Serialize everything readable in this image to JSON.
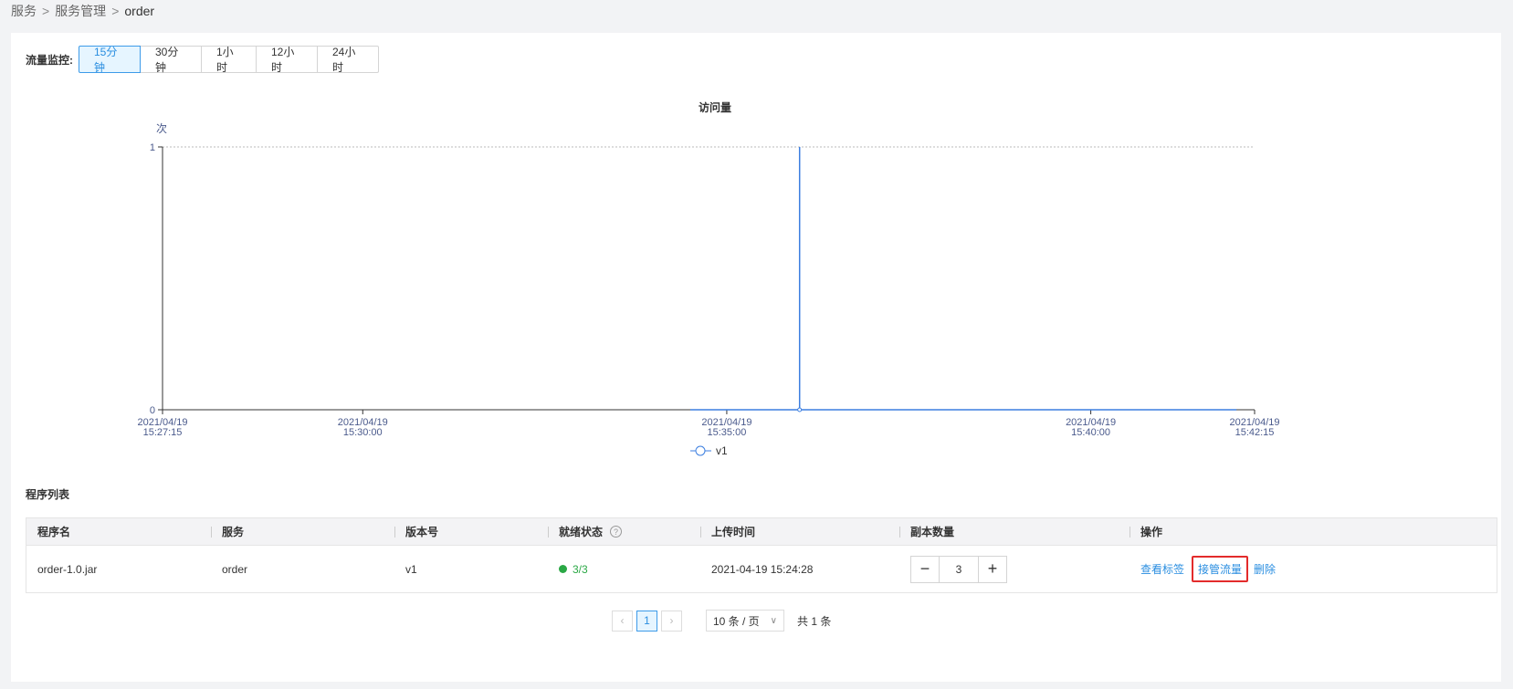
{
  "breadcrumb": {
    "items": [
      "服务",
      "服务管理",
      "order"
    ],
    "separator": ">"
  },
  "traffic": {
    "label": "流量监控:",
    "ranges": [
      "15分钟",
      "30分钟",
      "1小时",
      "12小时",
      "24小时"
    ],
    "active_index": 0
  },
  "chart_data": {
    "type": "line",
    "title": "访问量",
    "ylabel": "次",
    "xlabel": "",
    "ylim": [
      0,
      1
    ],
    "yticks": [
      0,
      1
    ],
    "xlim": [
      "2021/04/19 15:27:15",
      "2021/04/19 15:42:15"
    ],
    "xticks": [
      {
        "date": "2021/04/19",
        "time": "15:27:15"
      },
      {
        "date": "2021/04/19",
        "time": "15:30:00"
      },
      {
        "date": "2021/04/19",
        "time": "15:35:00"
      },
      {
        "date": "2021/04/19",
        "time": "15:40:00"
      },
      {
        "date": "2021/04/19",
        "time": "15:42:15"
      }
    ],
    "series": [
      {
        "name": "v1",
        "color": "#3b7ee0",
        "points": [
          {
            "x": "15:34:30",
            "y": 0
          },
          {
            "x": "15:36:00",
            "y": 0
          },
          {
            "x": "15:36:00",
            "y": 1
          },
          {
            "x": "15:36:00",
            "y": 0
          },
          {
            "x": "15:42:00",
            "y": 0
          }
        ],
        "marker": {
          "x": "15:36:00",
          "y": 0
        }
      }
    ],
    "legend_position": "bottom-center",
    "grid": "dotted-top"
  },
  "programs": {
    "title": "程序列表",
    "columns": [
      "程序名",
      "服务",
      "版本号",
      "就绪状态",
      "上传时间",
      "副本数量",
      "操作"
    ],
    "rows": [
      {
        "name": "order-1.0.jar",
        "service": "order",
        "version": "v1",
        "status": "3/3",
        "uploaded": "2021-04-19 15:24:28",
        "replicas": "3",
        "actions": [
          "查看标签",
          "接管流量",
          "删除"
        ]
      }
    ]
  },
  "pagination": {
    "current": "1",
    "page_size": "10 条 / 页",
    "total": "共 1 条"
  }
}
